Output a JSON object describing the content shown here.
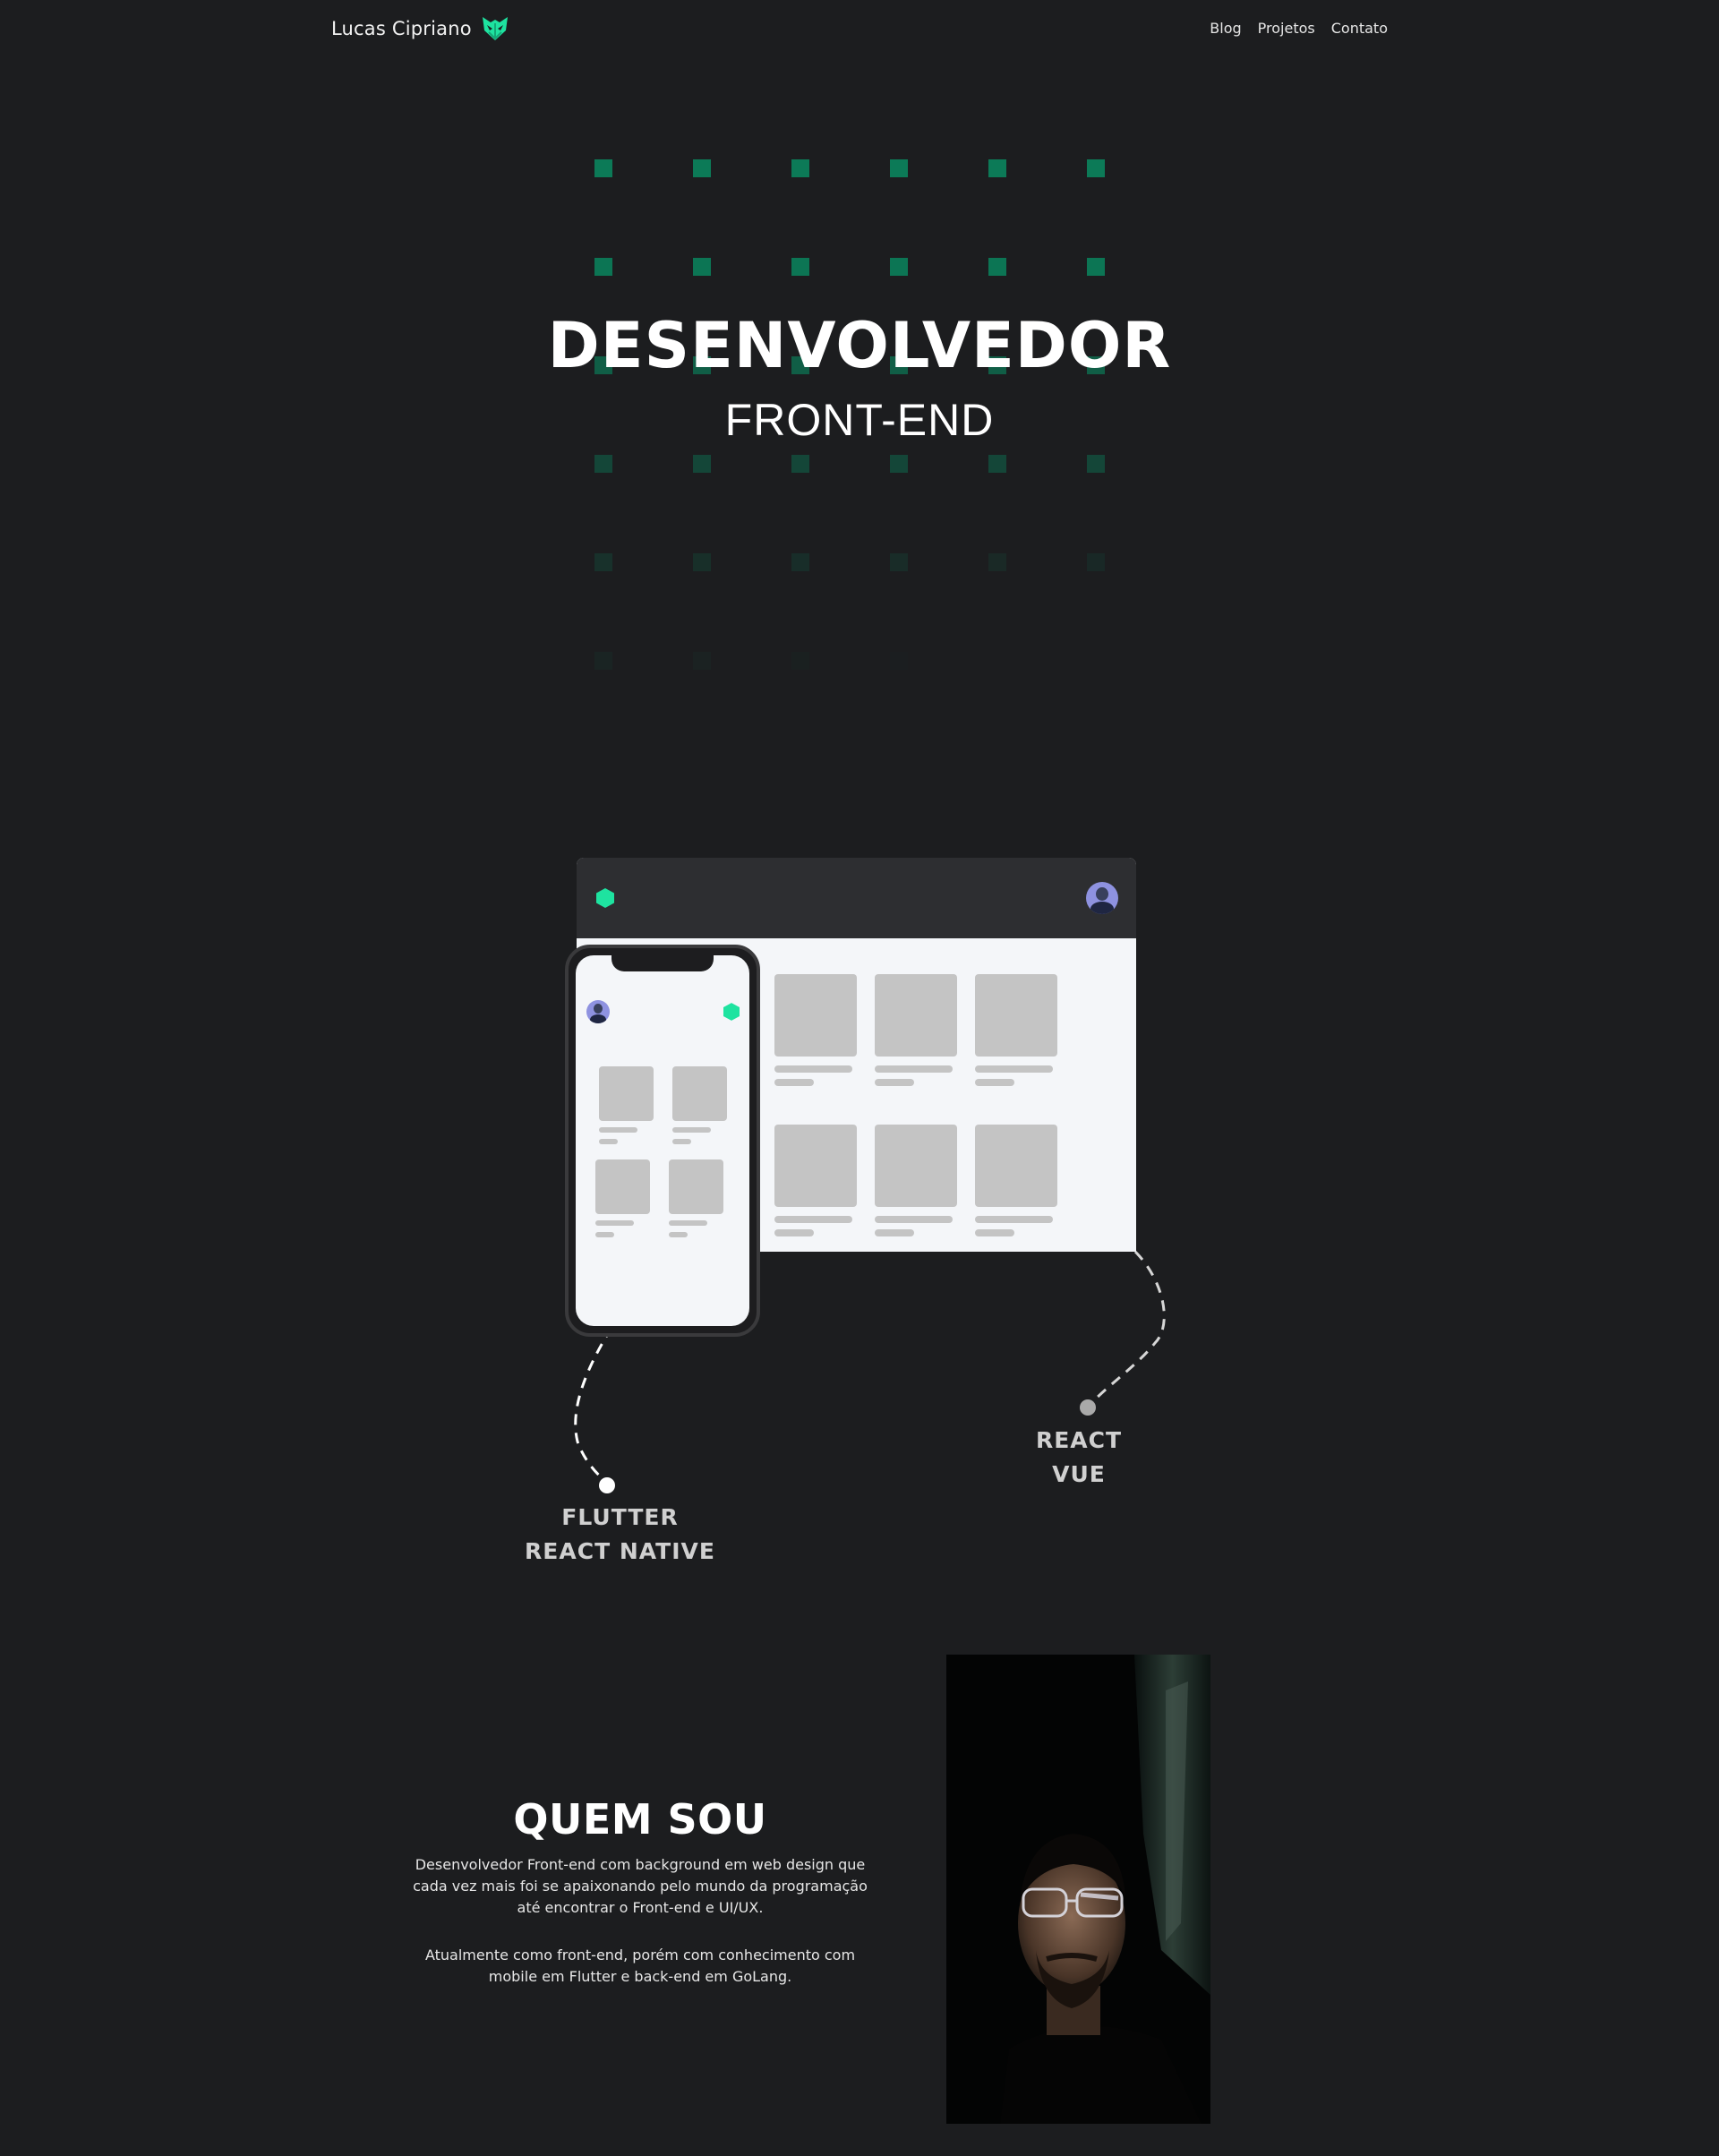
{
  "header": {
    "brand_name": "Lucas Cipriano",
    "logo_icon": "fox-logo-icon",
    "nav": [
      {
        "label": "Blog"
      },
      {
        "label": "Projetos"
      },
      {
        "label": "Contato"
      }
    ]
  },
  "hero": {
    "title": "DESENVOLVEDOR",
    "subtitle": "FRONT-END",
    "accent_color": "#0c7a57"
  },
  "illustration": {
    "web_stack": [
      "REACT",
      "VUE"
    ],
    "mobile_stack": [
      "FLUTTER",
      "REACT NATIVE"
    ],
    "brand_color": "#1ee3a0"
  },
  "about": {
    "title": "QUEM SOU",
    "paragraph_1": "Desenvolvedor Front-end com background em web design que cada vez mais foi se apaixonando pelo mundo da programação até encontrar o Front-end e UI/UX.",
    "paragraph_2": "Atualmente como front-end, porém com conhecimento com mobile em Flutter e back-end em GoLang."
  }
}
